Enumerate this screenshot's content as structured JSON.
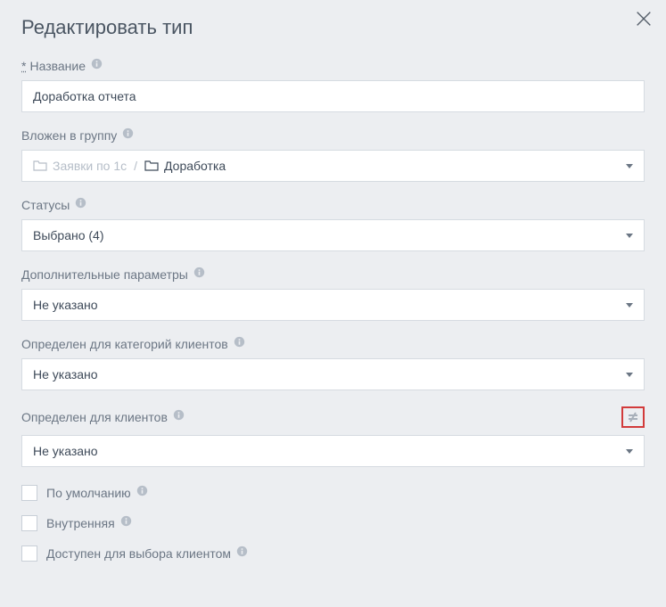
{
  "modal": {
    "title": "Редактировать тип"
  },
  "fields": {
    "name": {
      "label": "Название",
      "required_marker": "*",
      "value": "Доработка отчета"
    },
    "group": {
      "label": "Вложен в группу",
      "breadcrumb_parent": "Заявки по 1с",
      "breadcrumb_separator": "/",
      "breadcrumb_current": "Доработка"
    },
    "statuses": {
      "label": "Статусы",
      "value": "Выбрано (4)"
    },
    "extra_params": {
      "label": "Дополнительные параметры",
      "value": "Не указано"
    },
    "client_categories": {
      "label": "Определен для категорий клиентов",
      "value": "Не указано"
    },
    "clients": {
      "label": "Определен для клиентов",
      "value": "Не указано"
    }
  },
  "checkboxes": {
    "default": "По умолчанию",
    "internal": "Внутренняя",
    "client_selectable": "Доступен для выбора клиентом"
  }
}
